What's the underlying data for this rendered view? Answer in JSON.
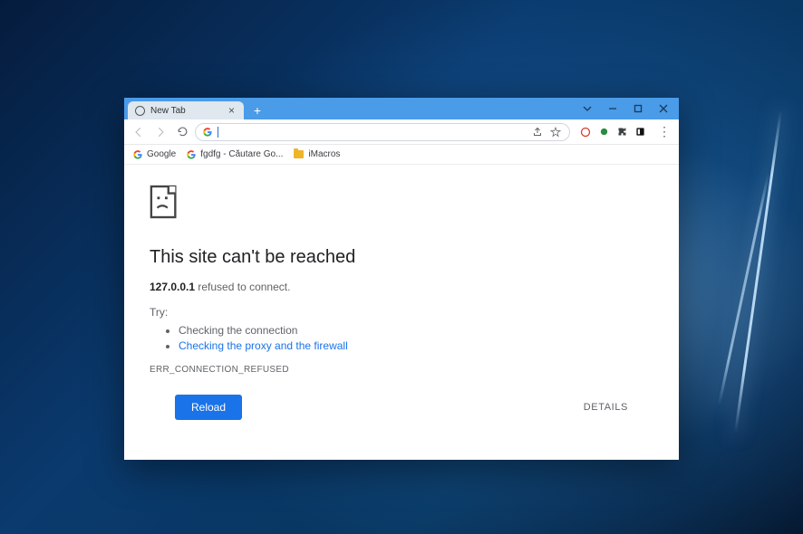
{
  "window": {
    "tab_title": "New Tab"
  },
  "bookmarks": [
    {
      "label": "Google"
    },
    {
      "label": "fgdfg - Căutare Go..."
    },
    {
      "label": "iMacros"
    }
  ],
  "omnibox": {
    "value": ""
  },
  "error": {
    "title": "This site can't be reached",
    "host": "127.0.0.1",
    "sub_suffix": " refused to connect.",
    "try_label": "Try:",
    "try_items": {
      "check_connection": "Checking the connection",
      "check_proxy": "Checking the proxy and the firewall"
    },
    "code": "ERR_CONNECTION_REFUSED",
    "reload_label": "Reload",
    "details_label": "DETAILS"
  }
}
